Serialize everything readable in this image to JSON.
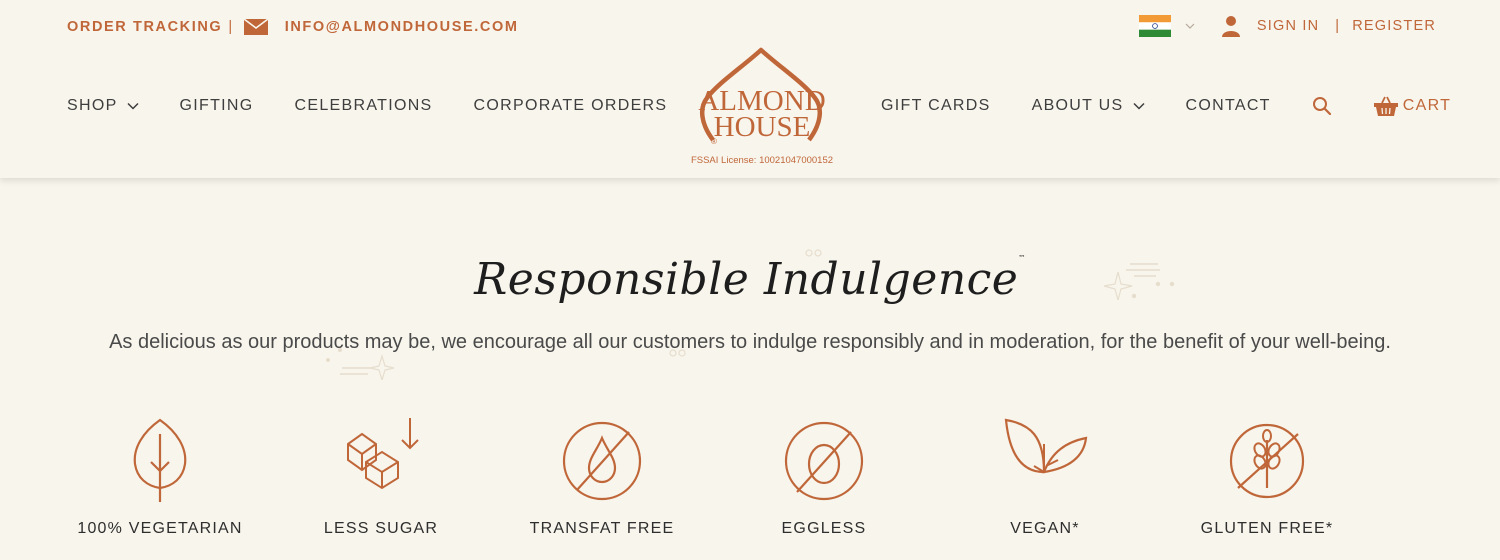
{
  "topbar": {
    "order_tracking": "ORDER TRACKING",
    "separator": "|",
    "email": "INFO@ALMONDHOUSE.COM",
    "sign_in": "SIGN IN",
    "divider": "|",
    "register": "REGISTER"
  },
  "nav": {
    "left": [
      "SHOP",
      "GIFTING",
      "CELEBRATIONS",
      "CORPORATE ORDERS"
    ],
    "right": [
      "GIFT CARDS",
      "ABOUT US",
      "CONTACT"
    ],
    "cart": "CART"
  },
  "logo": {
    "line1": "ALMOND",
    "line2": "HOUSE",
    "registered": "®",
    "fssai": "FSSAI License: 10021047000152"
  },
  "hero": {
    "title": "Responsible Indulgence",
    "trademark": "™",
    "subtitle": "As delicious as our products may be, we encourage all our customers to indulge responsibly and in moderation, for the benefit of your well-being."
  },
  "features": [
    {
      "label": "100% VEGETARIAN",
      "icon": "leaf-icon"
    },
    {
      "label": "LESS SUGAR",
      "icon": "sugar-cubes-icon"
    },
    {
      "label": "TRANSFAT FREE",
      "icon": "no-transfat-icon"
    },
    {
      "label": "EGGLESS",
      "icon": "no-egg-icon"
    },
    {
      "label": "VEGAN*",
      "icon": "vegan-leaves-icon"
    },
    {
      "label": "GLUTEN FREE*",
      "icon": "no-gluten-icon"
    }
  ],
  "colors": {
    "accent": "#c0673a",
    "background": "#f8f5ec",
    "text": "#3e3e3e"
  }
}
